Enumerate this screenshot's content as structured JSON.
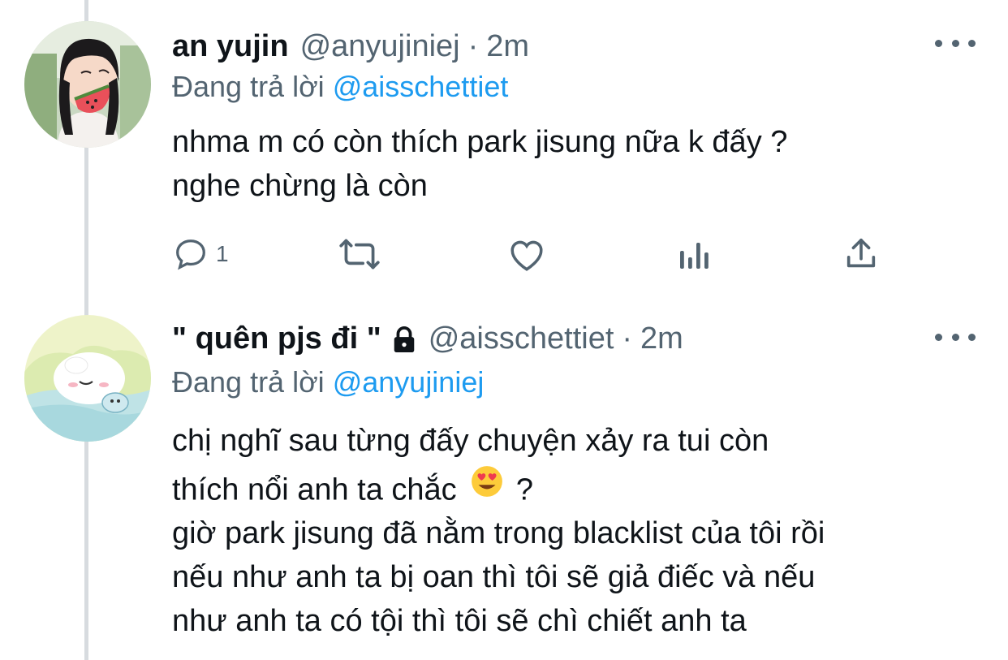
{
  "tweets": [
    {
      "display_name": "an yujin",
      "handle": "@anyujiniej",
      "separator": "·",
      "time": "2m",
      "reply_prefix": "Đang trả lời",
      "reply_to": "@aisschettiet",
      "lines": [
        "nhma m có còn thích park jisung nữa k đấy ?",
        "nghe chừng là còn"
      ],
      "actions": {
        "reply_count": "1"
      }
    },
    {
      "display_name": "\" quên pjs đi \"",
      "protected": true,
      "handle": "@aisschettiet",
      "separator": "·",
      "time": "2m",
      "reply_prefix": "Đang trả lời",
      "reply_to": "@anyujiniej",
      "lines": [
        "chị nghĩ sau từng đấy chuyện xảy ra tui còn",
        "thích nổi anh ta chắc",
        "?",
        "giờ park jisung đã nằm trong blacklist của tôi rồi",
        "nếu như anh ta bị oan thì tôi sẽ giả điếc và nếu",
        "như anh ta có tội thì tôi sẽ chì chiết anh ta"
      ]
    }
  ],
  "colors": {
    "text": "#0f1419",
    "secondary": "#536471",
    "accent": "#1d9bf0",
    "thread_line": "#d7dbdf"
  },
  "icons": [
    "more-icon",
    "reply-icon",
    "retweet-icon",
    "like-icon",
    "analytics-icon",
    "share-icon",
    "lock-icon",
    "heart-eyes-emoji"
  ]
}
